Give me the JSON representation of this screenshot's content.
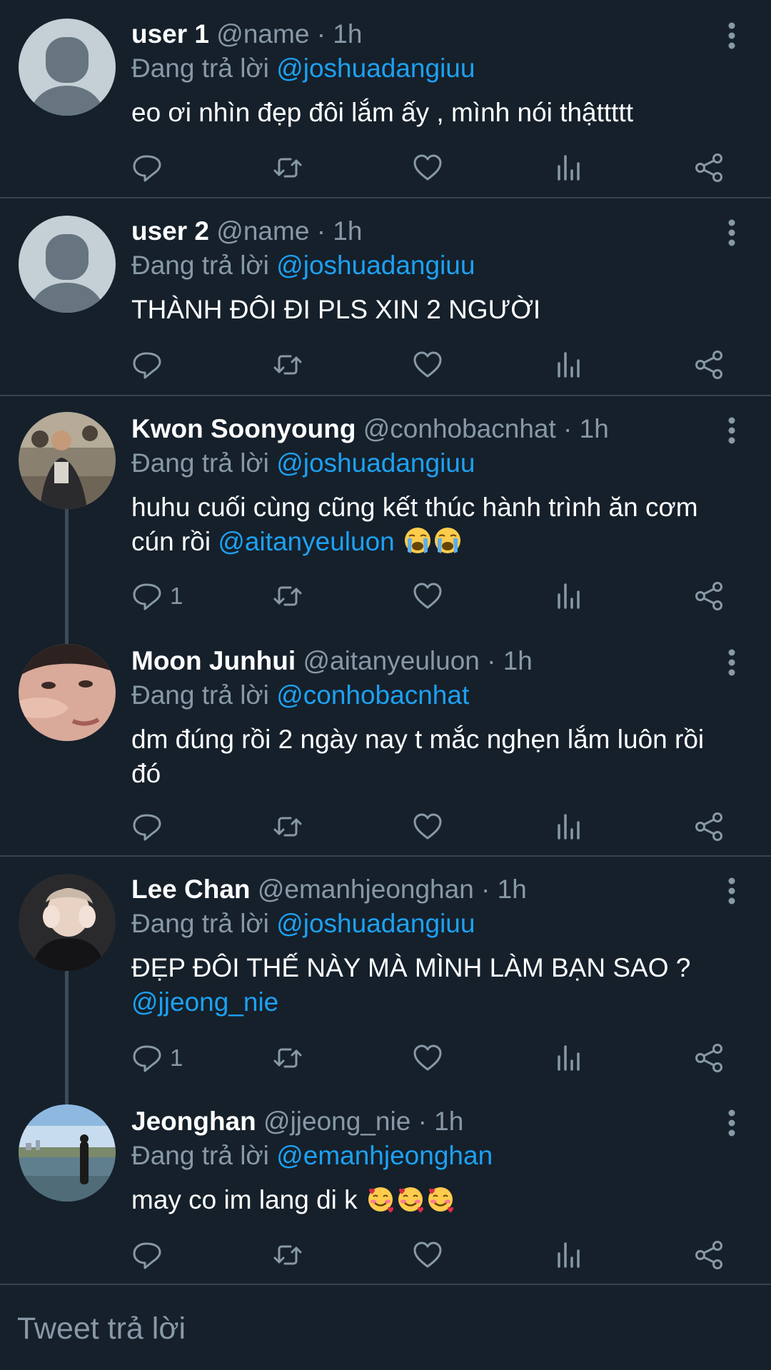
{
  "tweets": [
    {
      "display_name": "user 1",
      "meta": " @name · 1h",
      "replying_label": "Đang trả lời ",
      "replying_to": "@joshuadangiuu",
      "body": [
        {
          "text": "eo ơi nhìn đẹp đôi lắm ấy , mình nói thậttttt",
          "mention": false
        }
      ],
      "reply_count": "",
      "avatar": "default-avatar"
    },
    {
      "display_name": "user 2",
      "meta": " @name · 1h",
      "replying_label": "Đang trả lời ",
      "replying_to": "@joshuadangiuu",
      "body": [
        {
          "text": "THÀNH ĐÔI ĐI PLS XIN 2 NGƯỜI",
          "mention": false
        }
      ],
      "reply_count": "",
      "avatar": "default-avatar"
    },
    {
      "display_name": "Kwon Soonyoung",
      "meta": " @conhobacnhat · 1h",
      "replying_label": "Đang trả lời ",
      "replying_to": "@joshuadangiuu",
      "body": [
        {
          "text": "huhu cuối cùng cũng kết thúc hành trình ăn cơm cún rồi ",
          "mention": false
        },
        {
          "text": "@aitanyeuluon",
          "mention": true
        }
      ],
      "emoji": [
        "loudly-crying-face",
        "loudly-crying-face"
      ],
      "reply_count": "1",
      "avatar": "photo-avatar"
    },
    {
      "display_name": "Moon Junhui",
      "meta": " @aitanyeuluon · 1h",
      "replying_label": "Đang trả lời ",
      "replying_to": "@conhobacnhat",
      "body": [
        {
          "text": "dm đúng rồi 2 ngày nay t mắc nghẹn lắm luôn rồi đó",
          "mention": false
        }
      ],
      "reply_count": "",
      "avatar": "photo-avatar"
    },
    {
      "display_name": "Lee Chan",
      "meta": " @emanhjeonghan · 1h",
      "replying_label": "Đang trả lời ",
      "replying_to": "@joshuadangiuu",
      "body": [
        {
          "text": "ĐẸP ĐÔI THẾ NÀY MÀ MÌNH LÀM BẠN SAO ? ",
          "mention": false
        },
        {
          "text": "@jjeong_nie",
          "mention": true
        }
      ],
      "reply_count": "1",
      "avatar": "photo-avatar"
    },
    {
      "display_name": "Jeonghan",
      "meta": " @jjeong_nie · 1h",
      "replying_label": "Đang trả lời ",
      "replying_to": "@emanhjeonghan",
      "body": [
        {
          "text": "may co im lang di k ",
          "mention": false
        }
      ],
      "emoji": [
        "smiling-face-with-hearts",
        "smiling-face-with-hearts",
        "smiling-face-with-hearts"
      ],
      "reply_count": "",
      "avatar": "photo-avatar"
    }
  ],
  "action_icons": [
    "reply-icon",
    "retweet-icon",
    "like-icon",
    "analytics-icon",
    "share-icon",
    "more-icon"
  ],
  "compose": {
    "placeholder": "Tweet trả lời"
  },
  "colors": {
    "background": "#15202b",
    "text": "#ffffff",
    "secondary_text": "#8899a6",
    "mention": "#1da1f2",
    "divider": "#38444d",
    "thread_line": "#3d4c5a"
  }
}
